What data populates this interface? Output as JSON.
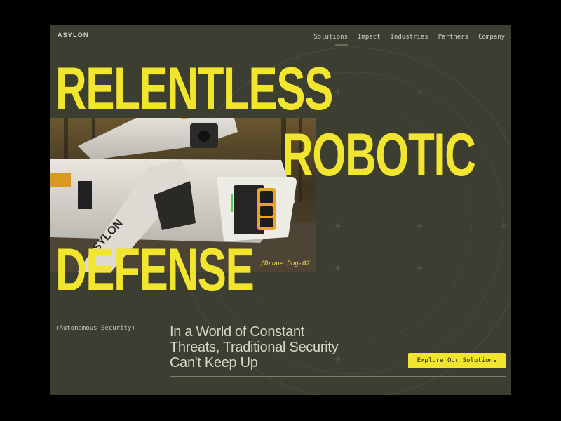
{
  "brand": {
    "logo": "ASYLON"
  },
  "nav": {
    "items": [
      "Solutions",
      "Impact",
      "Industries",
      "Partners",
      "Company"
    ]
  },
  "hero": {
    "line1": "RELENTLESS",
    "line2": "ROBOTIC",
    "line3": "DEFENSE",
    "photo_caption": "/Drone Dog-02",
    "photo_label": "ASYLON",
    "tagline": "(Autonomous Security)",
    "lead_lines": [
      "In a World of Constant",
      "Threats, Traditional Security",
      "Can't Keep Up"
    ],
    "cta_label": "Explore Our Solutions"
  },
  "colors": {
    "background": "#3b3e31",
    "accent": "#f2e530",
    "frame": "#000000"
  }
}
